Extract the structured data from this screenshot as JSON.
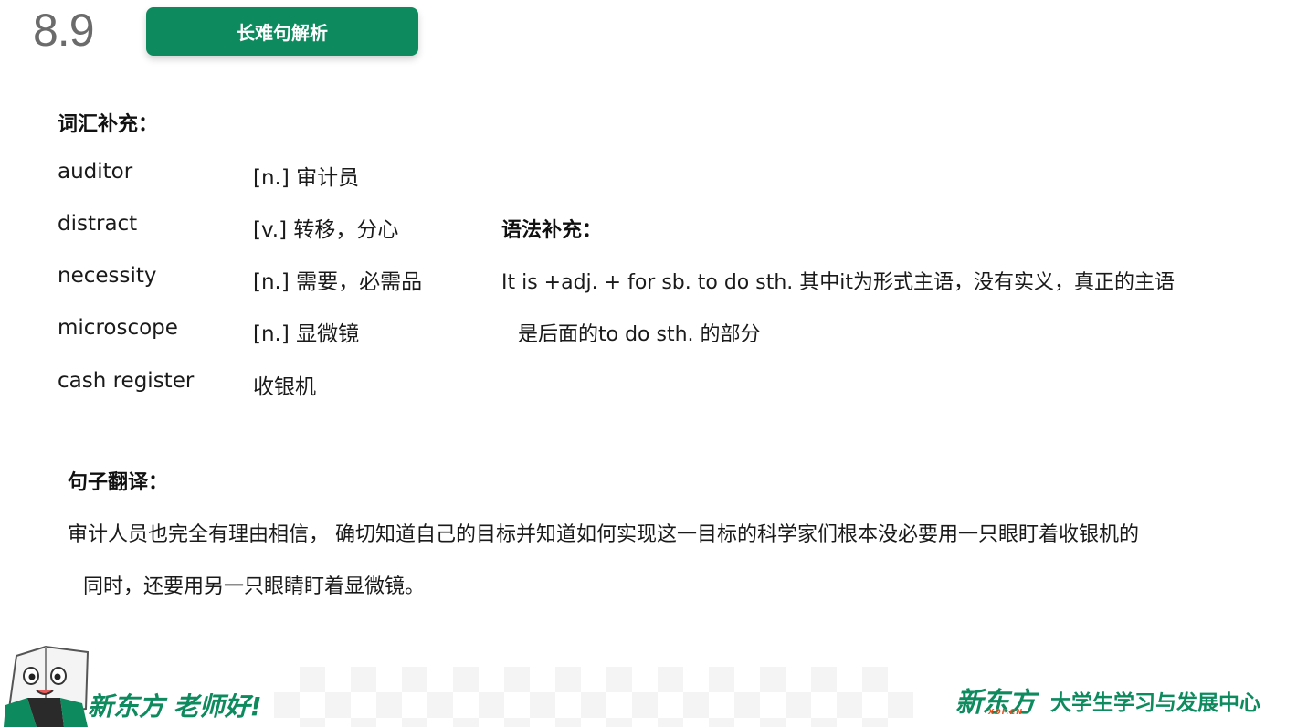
{
  "header": {
    "slide_number": "8.9",
    "title_button": "长难句解析"
  },
  "vocabulary": {
    "heading": "词汇补充：",
    "items": [
      {
        "word": "auditor",
        "definition": "[n.] 审计员"
      },
      {
        "word": "distract",
        "definition": "[v.] 转移，分心"
      },
      {
        "word": "necessity",
        "definition": "[n.] 需要，必需品"
      },
      {
        "word": "microscope",
        "definition": "[n.] 显微镜"
      },
      {
        "word": "cash register",
        "definition": "收银机"
      }
    ]
  },
  "grammar": {
    "heading": "语法补充：",
    "line1": "It is +adj. + for sb. to do sth. 其中it为形式主语，没有实义，真正的主语",
    "line2": "是后面的to do sth. 的部分"
  },
  "translation": {
    "heading": "句子翻译：",
    "line1": "审计人员也完全有理由相信， 确切知道自己的目标并知道如何实现这一目标的科学家们根本没必要用一只眼盯着收银机的",
    "line2": "同时，还要用另一只眼睛盯着显微镜。"
  },
  "footer": {
    "slogan": "新东方 老师好!",
    "logo": "新东方",
    "logo_sub": "XDF.CN",
    "center_name": "大学生学习与发展中心"
  },
  "colors": {
    "brand_green": "#0e8a5f",
    "logo_orange": "#e94e1b"
  }
}
